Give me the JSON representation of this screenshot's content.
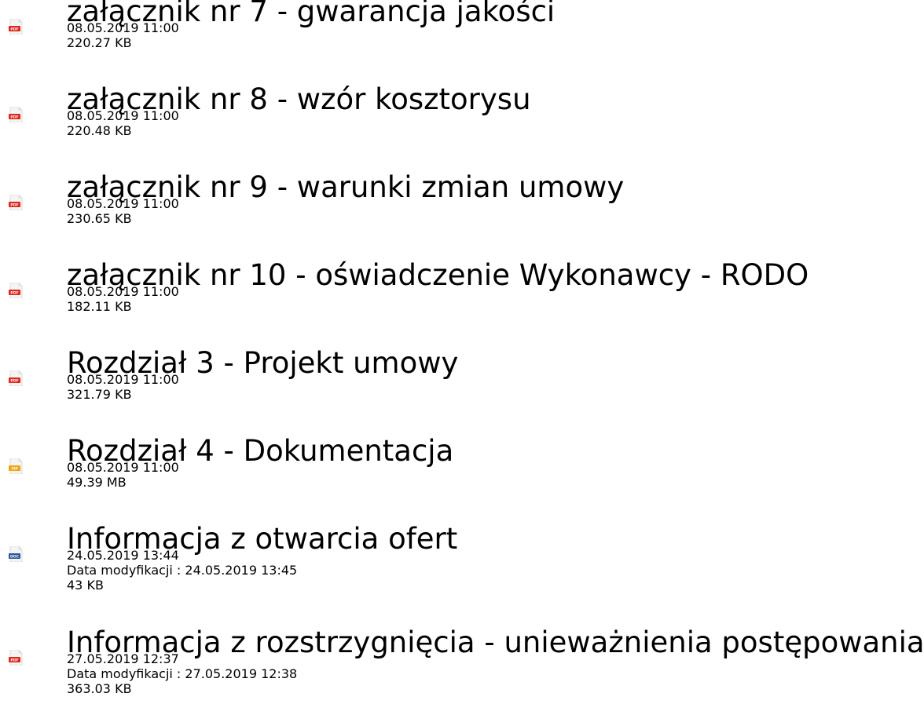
{
  "files": [
    {
      "title": "załącznik nr 7 - gwarancja jakości",
      "date": "08.05.2019 11:00",
      "modified": "",
      "size": "220.27 KB",
      "icon": "pdf-icon",
      "icon_label": "PDF",
      "icon_color": "#e2231a"
    },
    {
      "title": "załącznik nr 8 - wzór kosztorysu",
      "date": "08.05.2019 11:00",
      "modified": "",
      "size": "220.48 KB",
      "icon": "pdf-icon",
      "icon_label": "PDF",
      "icon_color": "#e2231a"
    },
    {
      "title": "załącznik nr 9 - warunki zmian umowy",
      "date": "08.05.2019 11:00",
      "modified": "",
      "size": "230.65 KB",
      "icon": "pdf-icon",
      "icon_label": "PDF",
      "icon_color": "#e2231a"
    },
    {
      "title": "załącznik nr 10 - oświadczenie Wykonawcy - RODO",
      "date": "08.05.2019 11:00",
      "modified": "",
      "size": "182.11 KB",
      "icon": "pdf-icon",
      "icon_label": "PDF",
      "icon_color": "#e2231a"
    },
    {
      "title": "Rozdział 3 - Projekt umowy",
      "date": "08.05.2019 11:00",
      "modified": "",
      "size": "321.79 KB",
      "icon": "pdf-icon",
      "icon_label": "PDF",
      "icon_color": "#e2231a"
    },
    {
      "title": "Rozdział 4 - Dokumentacja",
      "date": "08.05.2019 11:00",
      "modified": "",
      "size": "49.39 MB",
      "icon": "zip-icon",
      "icon_label": "ZIP",
      "icon_color": "#f0a30a"
    },
    {
      "title": "Informacja z otwarcia ofert",
      "date": "24.05.2019 13:44",
      "modified": "Data modyfikacji : 24.05.2019 13:45",
      "size": "43 KB",
      "icon": "doc-icon",
      "icon_label": "DOC",
      "icon_color": "#2b579a"
    },
    {
      "title": "Informacja z rozstrzygnięcia - unieważnienia postępowania",
      "date": "27.05.2019 12:37",
      "modified": "Data modyfikacji : 27.05.2019 12:38",
      "size": "363.03 KB",
      "icon": "pdf-icon",
      "icon_label": "PDF",
      "icon_color": "#e2231a"
    }
  ]
}
